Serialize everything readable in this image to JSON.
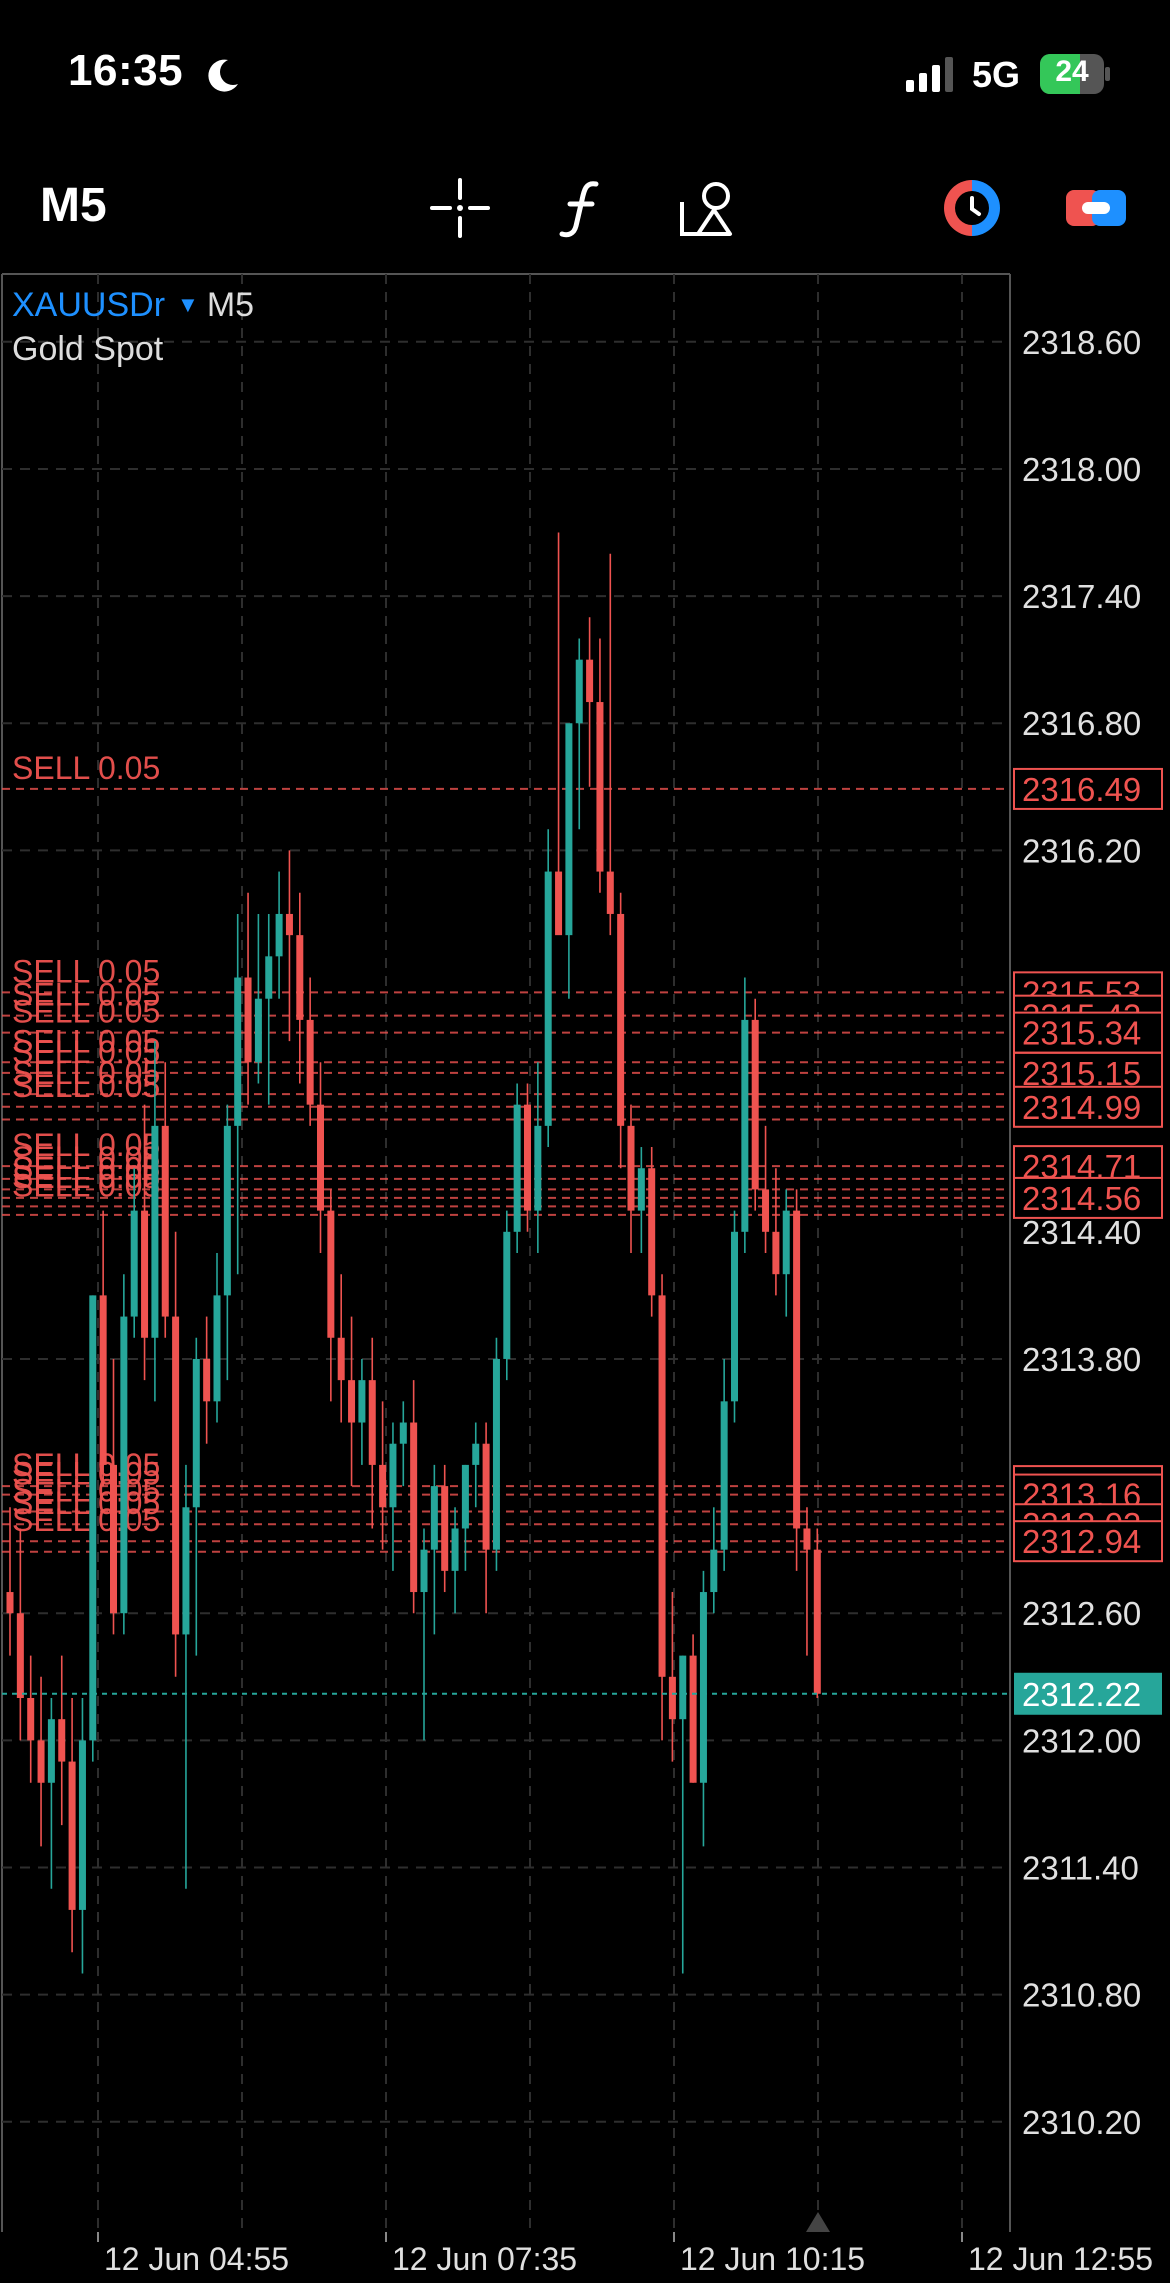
{
  "status_bar": {
    "time": "16:35",
    "network": "5G",
    "battery": "24"
  },
  "toolbar": {
    "timeframe": "M5",
    "icons": [
      "crosshair-icon",
      "indicator-icon",
      "objects-icon",
      "trade-icon",
      "account-icon"
    ]
  },
  "header": {
    "symbol": "XAUUSDr",
    "timeframe": "M5",
    "description": "Gold Spot"
  },
  "colors": {
    "bull": "#26a69a",
    "bear": "#ef5350",
    "grid": "#2e2e2e",
    "bid": "#26a69a",
    "sell": "#ef5350"
  },
  "chart_data": {
    "type": "candlestick",
    "ylim": [
      2309.68,
      2318.92
    ],
    "y_ticks": [
      "2318.60",
      "2318.00",
      "2317.40",
      "2316.80",
      "2316.20",
      "2313.80",
      "2312.60",
      "2312.00",
      "2311.40",
      "2310.80",
      "2310.20"
    ],
    "x_ticks": [
      "12 Jun 04:55",
      "12 Jun 07:35",
      "12 Jun 10:15",
      "12 Jun 12:55"
    ],
    "current_price": "2312.22",
    "sell_order_label": "SELL 0.05",
    "sell_levels": [
      2316.49,
      2315.53,
      2315.42,
      2315.34,
      2315.2,
      2315.15,
      2315.05,
      2314.99,
      2314.93,
      2314.71,
      2314.65,
      2314.6,
      2314.56,
      2314.52,
      2314.48,
      2313.2,
      2313.16,
      2313.08,
      2313.02,
      2312.94,
      2312.89
    ],
    "sell_price_badges": [
      "2316.49",
      "2315.53",
      "2315.42",
      "2315.34",
      "2315.15",
      "2314.99",
      "2314.71",
      "2314.56",
      "2313.20",
      "2313.16",
      "2313.02",
      "2312.94"
    ],
    "partly_hidden_tick": "2314.40",
    "candles": [
      [
        2312.7,
        2313.1,
        2312.4,
        2312.6
      ],
      [
        2312.6,
        2313.0,
        2312.0,
        2312.2
      ],
      [
        2312.2,
        2312.4,
        2311.8,
        2312.0
      ],
      [
        2312.0,
        2312.3,
        2311.5,
        2311.8
      ],
      [
        2311.8,
        2312.2,
        2311.3,
        2312.1
      ],
      [
        2312.1,
        2312.4,
        2311.6,
        2311.9
      ],
      [
        2311.9,
        2312.2,
        2311.0,
        2311.2
      ],
      [
        2311.2,
        2312.2,
        2310.9,
        2312.0
      ],
      [
        2312.0,
        2314.1,
        2311.9,
        2314.1
      ],
      [
        2314.1,
        2314.5,
        2313.2,
        2313.3
      ],
      [
        2313.3,
        2313.8,
        2312.5,
        2312.6
      ],
      [
        2312.6,
        2314.2,
        2312.5,
        2314.0
      ],
      [
        2314.0,
        2314.7,
        2313.9,
        2314.5
      ],
      [
        2314.5,
        2315.0,
        2313.7,
        2313.9
      ],
      [
        2313.9,
        2315.3,
        2313.6,
        2314.9
      ],
      [
        2314.9,
        2315.2,
        2313.9,
        2314.0
      ],
      [
        2314.0,
        2314.4,
        2312.3,
        2312.5
      ],
      [
        2312.5,
        2313.3,
        2311.3,
        2313.1
      ],
      [
        2313.1,
        2313.9,
        2312.4,
        2313.8
      ],
      [
        2313.8,
        2314.0,
        2313.4,
        2313.6
      ],
      [
        2313.6,
        2314.3,
        2313.5,
        2314.1
      ],
      [
        2314.1,
        2315.0,
        2313.7,
        2314.9
      ],
      [
        2314.9,
        2315.9,
        2314.2,
        2315.6
      ],
      [
        2315.6,
        2316.0,
        2315.0,
        2315.2
      ],
      [
        2315.2,
        2315.9,
        2315.1,
        2315.5
      ],
      [
        2315.5,
        2315.9,
        2315.0,
        2315.7
      ],
      [
        2315.7,
        2316.1,
        2315.5,
        2315.9
      ],
      [
        2315.9,
        2316.2,
        2315.3,
        2315.8
      ],
      [
        2315.8,
        2316.0,
        2315.1,
        2315.4
      ],
      [
        2315.4,
        2315.6,
        2314.9,
        2315.0
      ],
      [
        2315.0,
        2315.2,
        2314.3,
        2314.5
      ],
      [
        2314.5,
        2314.6,
        2313.6,
        2313.9
      ],
      [
        2313.9,
        2314.2,
        2313.5,
        2313.7
      ],
      [
        2313.7,
        2314.0,
        2313.2,
        2313.5
      ],
      [
        2313.5,
        2313.8,
        2313.3,
        2313.7
      ],
      [
        2313.7,
        2313.9,
        2313.0,
        2313.3
      ],
      [
        2313.3,
        2313.6,
        2312.9,
        2313.1
      ],
      [
        2313.1,
        2313.5,
        2312.8,
        2313.4
      ],
      [
        2313.4,
        2313.6,
        2313.2,
        2313.5
      ],
      [
        2313.5,
        2313.7,
        2312.6,
        2312.7
      ],
      [
        2312.7,
        2313.0,
        2312.0,
        2312.9
      ],
      [
        2312.9,
        2313.3,
        2312.5,
        2313.2
      ],
      [
        2313.2,
        2313.3,
        2312.7,
        2312.8
      ],
      [
        2312.8,
        2313.1,
        2312.6,
        2313.0
      ],
      [
        2313.0,
        2313.3,
        2312.8,
        2313.3
      ],
      [
        2313.3,
        2313.5,
        2313.1,
        2313.4
      ],
      [
        2313.4,
        2313.5,
        2312.6,
        2312.9
      ],
      [
        2312.9,
        2313.9,
        2312.8,
        2313.8
      ],
      [
        2313.8,
        2314.5,
        2313.7,
        2314.4
      ],
      [
        2314.4,
        2315.1,
        2314.3,
        2315.0
      ],
      [
        2315.0,
        2315.1,
        2314.4,
        2314.5
      ],
      [
        2314.5,
        2315.2,
        2314.3,
        2314.9
      ],
      [
        2314.9,
        2316.3,
        2314.8,
        2316.1
      ],
      [
        2316.1,
        2317.7,
        2315.9,
        2315.8
      ],
      [
        2315.8,
        2316.6,
        2315.5,
        2316.8
      ],
      [
        2316.8,
        2317.2,
        2316.3,
        2317.1
      ],
      [
        2317.1,
        2317.3,
        2316.5,
        2316.9
      ],
      [
        2316.9,
        2317.2,
        2316.0,
        2316.1
      ],
      [
        2316.1,
        2317.6,
        2315.8,
        2315.9
      ],
      [
        2315.9,
        2316.0,
        2314.7,
        2314.9
      ],
      [
        2314.9,
        2315.0,
        2314.3,
        2314.5
      ],
      [
        2314.5,
        2314.8,
        2314.3,
        2314.7
      ],
      [
        2314.7,
        2314.8,
        2314.0,
        2314.1
      ],
      [
        2314.1,
        2314.2,
        2312.0,
        2312.3
      ],
      [
        2312.3,
        2312.7,
        2311.9,
        2312.1
      ],
      [
        2312.1,
        2312.4,
        2310.9,
        2312.4
      ],
      [
        2312.4,
        2312.5,
        2311.8,
        2311.8
      ],
      [
        2311.8,
        2312.8,
        2311.5,
        2312.7
      ],
      [
        2312.7,
        2313.1,
        2312.6,
        2312.9
      ],
      [
        2312.9,
        2313.8,
        2312.8,
        2313.6
      ],
      [
        2313.6,
        2314.5,
        2313.5,
        2314.4
      ],
      [
        2314.4,
        2315.6,
        2314.3,
        2315.4
      ],
      [
        2315.4,
        2315.5,
        2314.5,
        2314.6
      ],
      [
        2314.6,
        2314.9,
        2314.3,
        2314.4
      ],
      [
        2314.4,
        2314.7,
        2314.1,
        2314.2
      ],
      [
        2314.2,
        2314.6,
        2314.0,
        2314.5
      ],
      [
        2314.5,
        2314.6,
        2312.8,
        2313.0
      ],
      [
        2313.0,
        2313.1,
        2312.4,
        2312.9
      ],
      [
        2312.9,
        2313.0,
        2312.2,
        2312.22
      ]
    ]
  }
}
